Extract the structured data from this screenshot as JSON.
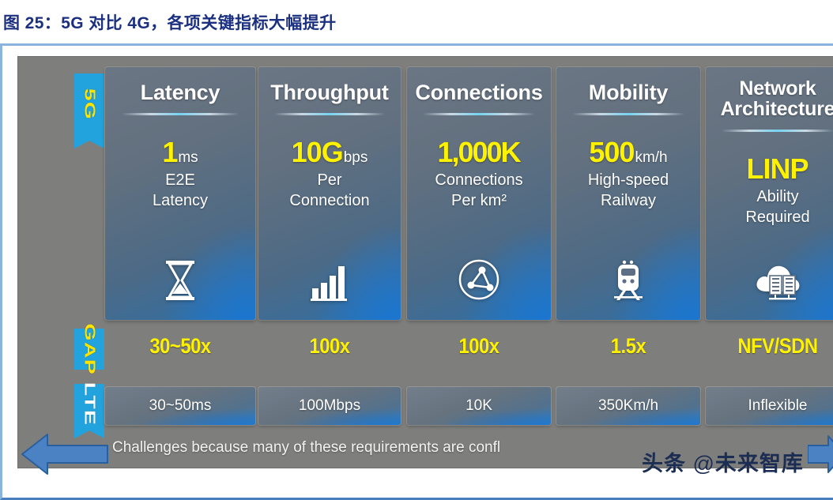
{
  "caption": "图 25：5G 对比 4G，各项关键指标大幅提升",
  "ribbons": {
    "five_g": "5G",
    "gap": "GAP",
    "lte": "LTE"
  },
  "columns": [
    {
      "title": "Latency",
      "metric_big": "1",
      "metric_unit": "ms",
      "metric_desc_line1": "E2E",
      "metric_desc_line2": "Latency",
      "icon": "hourglass-icon",
      "gap": "30~50x",
      "lte": "30~50ms"
    },
    {
      "title": "Throughput",
      "metric_big": "10G",
      "metric_unit": "bps",
      "metric_desc_line1": "Per",
      "metric_desc_line2": "Connection",
      "icon": "bar-chart-icon",
      "gap": "100x",
      "lte": "100Mbps"
    },
    {
      "title": "Connections",
      "metric_big": "1,000K",
      "metric_unit": "",
      "metric_desc_line1": "Connections",
      "metric_desc_line2": "Per km²",
      "icon": "network-nodes-icon",
      "gap": "100x",
      "lte": "10K"
    },
    {
      "title": "Mobility",
      "metric_big": "500",
      "metric_unit": "km/h",
      "metric_desc_line1": "High-speed",
      "metric_desc_line2": "Railway",
      "icon": "train-icon",
      "gap": "1.5x",
      "lte": "350Km/h"
    },
    {
      "title": "Network Architecture",
      "metric_big": "LINP",
      "metric_unit": "",
      "metric_desc_line1": "Ability",
      "metric_desc_line2": "Required",
      "icon": "cloud-servers-icon",
      "gap": "NFV/SDN",
      "lte": "Inflexible"
    }
  ],
  "banner": {
    "text": "Challenges because many of these requirements are confl",
    "left_arrow": "arrow-left-icon",
    "right_arrow": "arrow-right-icon"
  },
  "watermark": {
    "brand": "头条",
    "at": " @",
    "account": "未来智库"
  },
  "colors": {
    "ribbon_blue": "#22a3dd",
    "yellow": "#fff200",
    "stage_gray": "#7e7e7c",
    "caption_navy": "#1b3080",
    "arrow_blue": "#4a82c4"
  }
}
